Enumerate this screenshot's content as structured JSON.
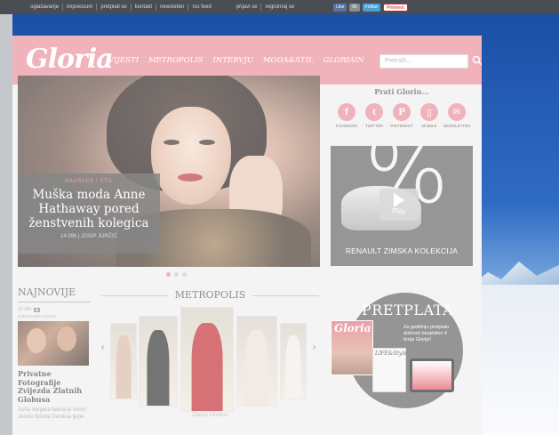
{
  "topbar": {
    "links_left": [
      "oglašavanje",
      "impressum",
      "pretplati se",
      "kontakt",
      "newsletter",
      "rss feed"
    ],
    "links_right": [
      "prijavi se",
      "registriraj se"
    ],
    "social": {
      "like": "Like",
      "t": "0k",
      "follow": "Follow",
      "pinterest": "Pinterest"
    }
  },
  "header": {
    "logo": "Gloria",
    "nav": [
      "VIJESTI",
      "METROPOLIS",
      "INTERVJU",
      "MODA&STIL",
      "GLORIAIN"
    ],
    "search_placeholder": "Pretraži..."
  },
  "hero": {
    "category": "NAGRADE I STIL",
    "title": "Muška moda Anne Hathaway pored ženstvenih kolegica",
    "meta": "14.09h  |  JOSIP JURČIĆ",
    "slides": 3,
    "active_slide": 0
  },
  "follow": {
    "title": "Prati Gloriu...",
    "items": [
      {
        "label": "FACEBOOK",
        "icon": "facebook-icon",
        "glyph": "f"
      },
      {
        "label": "TWITTER",
        "icon": "twitter-icon",
        "glyph": "t"
      },
      {
        "label": "PINTEREST",
        "icon": "pinterest-icon",
        "glyph": "P"
      },
      {
        "label": "MOBILE",
        "icon": "mobile-icon",
        "glyph": "▯"
      },
      {
        "label": "NEWSLETTER",
        "icon": "newsletter-icon",
        "glyph": "✉"
      }
    ]
  },
  "ad": {
    "big_text": "%",
    "play_label": "Play",
    "caption": "RENAULT ZIMSKA KOLEKCIJA"
  },
  "najnovije": {
    "title": "NAJNOVIJE",
    "time": "16:34h",
    "category": "ZABAVA ZZA KULISA",
    "headline": "Privatne Fotografije Zvijezda Zlatnih Globusa",
    "excerpt": "Sofía Vergara bacila je okom Jenniu Bonda Deloksa ljepo"
  },
  "metropolis": {
    "title": "METROPOLIS",
    "caption": "Zlatni Globus",
    "prev": "‹",
    "next": "›"
  },
  "pretplata": {
    "title": "PRETPLATA",
    "text": "Za godišnju pretplatu dobivaš besplatno 4 broja Glorije!",
    "mag1": "Gloria",
    "mag2": "LIFE&Style"
  },
  "colors": {
    "accent": "#e98b98",
    "topbar": "#4a4d52",
    "ad_bg": "#5f5f5f"
  }
}
